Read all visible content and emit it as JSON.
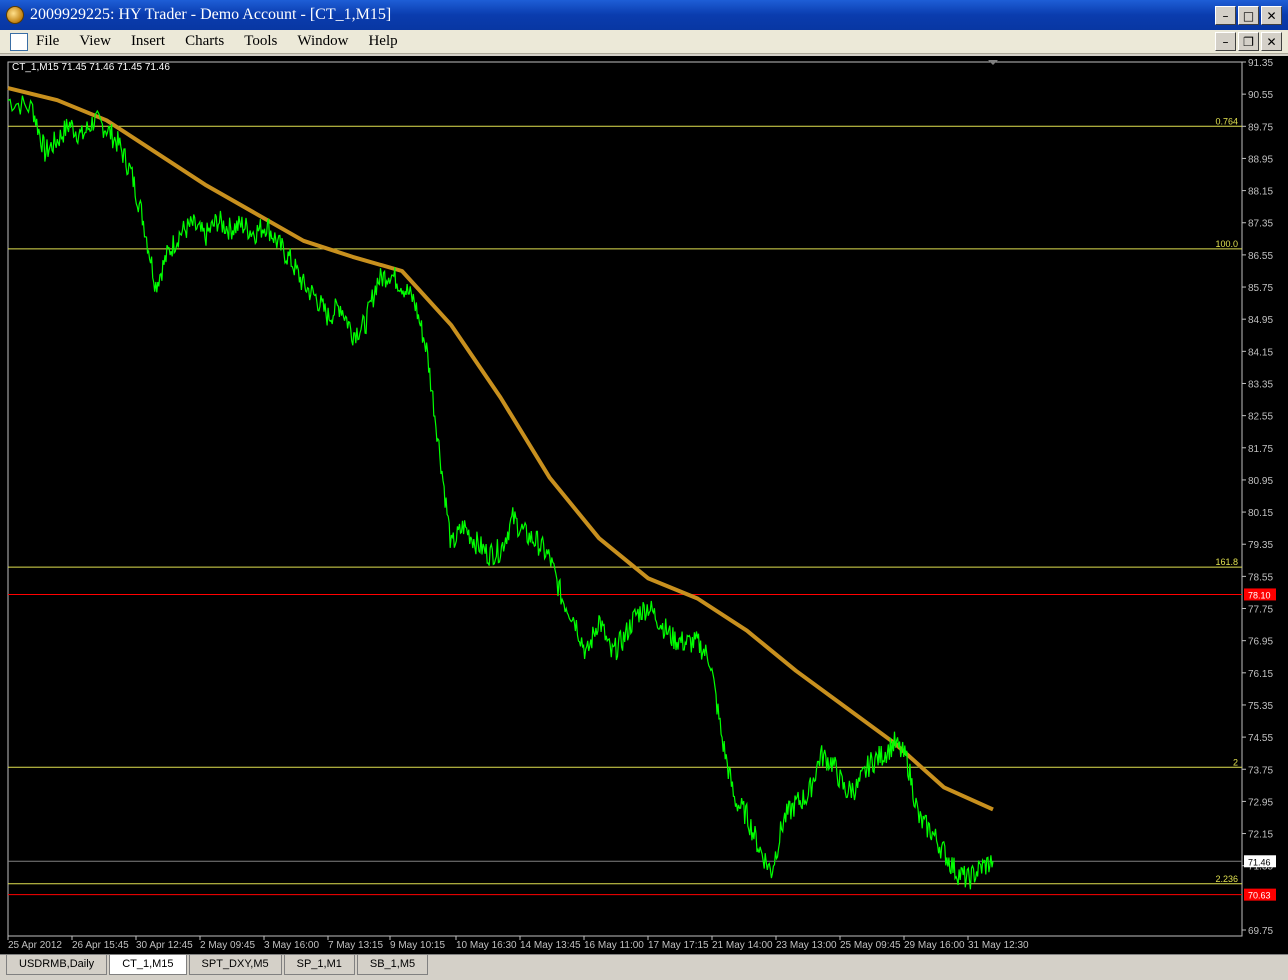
{
  "window": {
    "title": "2009929225: HY Trader - Demo Account - [CT_1,M15]",
    "minimize": "–",
    "maximize": "□",
    "close": "✕",
    "restore": "❐"
  },
  "menu": [
    "File",
    "View",
    "Insert",
    "Charts",
    "Tools",
    "Window",
    "Help"
  ],
  "chart": {
    "info": "CT_1,M15  71.45 71.46 71.45 71.46",
    "background": "#000000",
    "price_color": "#00ff00",
    "ma_color": "#c8901e",
    "fib_color": "#e0e050",
    "sr_color": "#ff0000",
    "current_price": "71.46",
    "ylim": [
      69.75,
      91.35
    ],
    "y_ticks": [
      "91.35",
      "90.55",
      "89.75",
      "88.95",
      "88.15",
      "87.35",
      "86.55",
      "85.75",
      "84.95",
      "84.15",
      "83.35",
      "82.55",
      "81.75",
      "80.95",
      "80.15",
      "79.35",
      "78.55",
      "77.75",
      "76.95",
      "76.15",
      "75.35",
      "74.55",
      "73.75",
      "72.95",
      "72.15",
      "71.35",
      "69.75"
    ],
    "x_ticks": [
      "25 Apr 2012",
      "26 Apr 15:45",
      "30 Apr 12:45",
      "2 May 09:45",
      "3 May 16:00",
      "7 May 13:15",
      "9 May 10:15",
      "10 May 16:30",
      "14 May 13:45",
      "16 May 11:00",
      "17 May 17:15",
      "21 May 14:00",
      "23 May 13:00",
      "25 May 09:45",
      "29 May 16:00",
      "31 May 12:30"
    ],
    "fib_levels": [
      {
        "label": "0.764",
        "value": 89.75
      },
      {
        "label": "100.0",
        "value": 86.7
      },
      {
        "label": "161.8",
        "value": 78.78
      },
      {
        "label": "2",
        "value": 73.8
      },
      {
        "label": "2.236",
        "value": 70.9
      }
    ],
    "sr_levels": [
      {
        "label": "78.10",
        "value": 78.1
      },
      {
        "label": "70.63",
        "value": 70.63
      }
    ],
    "price_series": [
      [
        0,
        90.4
      ],
      [
        2,
        90.2
      ],
      [
        3,
        89.1
      ],
      [
        4,
        89.4
      ],
      [
        5,
        89.8
      ],
      [
        6,
        89.5
      ],
      [
        7,
        89.9
      ],
      [
        8,
        89.7
      ],
      [
        9,
        89.3
      ],
      [
        10,
        88.6
      ],
      [
        11,
        87.4
      ],
      [
        12,
        85.8
      ],
      [
        13,
        86.6
      ],
      [
        14,
        87.1
      ],
      [
        15,
        87.3
      ],
      [
        16,
        87.0
      ],
      [
        17,
        87.4
      ],
      [
        18,
        87.2
      ],
      [
        19,
        87.3
      ],
      [
        20,
        87.1
      ],
      [
        21,
        87.3
      ],
      [
        22,
        86.8
      ],
      [
        23,
        86.4
      ],
      [
        24,
        85.8
      ],
      [
        25,
        85.5
      ],
      [
        26,
        85.0
      ],
      [
        27,
        85.3
      ],
      [
        28,
        84.6
      ],
      [
        29,
        84.8
      ],
      [
        30,
        85.9
      ],
      [
        31,
        86.1
      ],
      [
        32,
        85.8
      ],
      [
        33,
        85.4
      ],
      [
        34,
        84.2
      ],
      [
        35,
        81.8
      ],
      [
        36,
        79.3
      ],
      [
        37,
        79.8
      ],
      [
        38,
        79.4
      ],
      [
        39,
        79.1
      ],
      [
        40,
        79.2
      ],
      [
        41,
        80.0
      ],
      [
        42,
        79.6
      ],
      [
        43,
        79.4
      ],
      [
        44,
        79.0
      ],
      [
        45,
        78.0
      ],
      [
        46,
        77.5
      ],
      [
        47,
        76.6
      ],
      [
        48,
        77.5
      ],
      [
        49,
        76.6
      ],
      [
        50,
        77.0
      ],
      [
        51,
        77.6
      ],
      [
        52,
        77.8
      ],
      [
        53,
        77.4
      ],
      [
        54,
        77.0
      ],
      [
        55,
        76.9
      ],
      [
        56,
        76.9
      ],
      [
        57,
        76.5
      ],
      [
        58,
        74.5
      ],
      [
        59,
        73.0
      ],
      [
        60,
        72.6
      ],
      [
        61,
        71.8
      ],
      [
        62,
        71.2
      ],
      [
        63,
        72.5
      ],
      [
        64,
        72.9
      ],
      [
        65,
        73.1
      ],
      [
        66,
        74.1
      ],
      [
        67,
        73.9
      ],
      [
        68,
        73.2
      ],
      [
        69,
        73.3
      ],
      [
        70,
        73.9
      ],
      [
        71,
        74.1
      ],
      [
        72,
        74.4
      ],
      [
        73,
        74.0
      ],
      [
        74,
        72.5
      ],
      [
        75,
        72.2
      ],
      [
        76,
        71.7
      ],
      [
        77,
        71.2
      ],
      [
        78,
        71.0
      ],
      [
        79,
        71.3
      ],
      [
        80,
        71.46
      ]
    ],
    "ma_series": [
      [
        0,
        90.7
      ],
      [
        4,
        90.4
      ],
      [
        8,
        89.9
      ],
      [
        12,
        89.1
      ],
      [
        16,
        88.3
      ],
      [
        20,
        87.6
      ],
      [
        24,
        86.9
      ],
      [
        28,
        86.5
      ],
      [
        32,
        86.15
      ],
      [
        36,
        84.8
      ],
      [
        40,
        83.0
      ],
      [
        44,
        81.0
      ],
      [
        48,
        79.5
      ],
      [
        52,
        78.5
      ],
      [
        56,
        78.0
      ],
      [
        60,
        77.2
      ],
      [
        64,
        76.2
      ],
      [
        68,
        75.3
      ],
      [
        72,
        74.4
      ],
      [
        76,
        73.3
      ],
      [
        80,
        72.75
      ]
    ]
  },
  "tabs": [
    {
      "label": "USDRMB,Daily",
      "active": false
    },
    {
      "label": "CT_1,M15",
      "active": true
    },
    {
      "label": "SPT_DXY,M5",
      "active": false
    },
    {
      "label": "SP_1,M1",
      "active": false
    },
    {
      "label": "SB_1,M5",
      "active": false
    }
  ]
}
